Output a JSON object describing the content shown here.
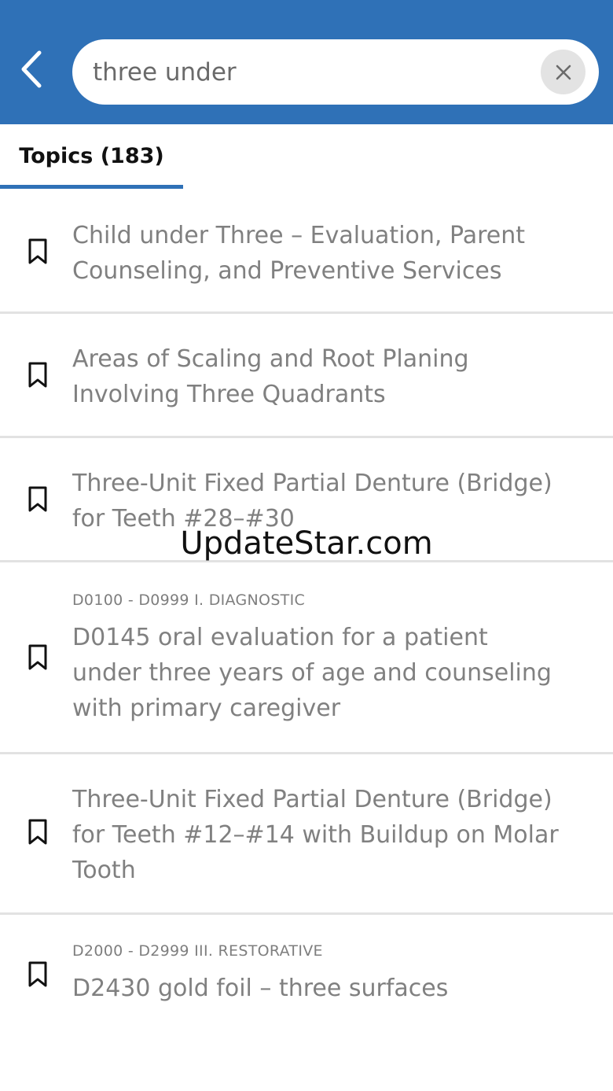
{
  "header": {
    "back_icon": "chevron-left-icon",
    "search": {
      "value": "three under",
      "placeholder": "",
      "clear_icon": "close-icon"
    },
    "colors": {
      "bar": "#2f71b7"
    }
  },
  "tabs": [
    {
      "label": "Topics (183)",
      "active": true
    }
  ],
  "results": [
    {
      "category": "",
      "title_lines": [
        "Child under Three – Evaluation, Parent",
        "Counseling, and Preventive Services"
      ],
      "icon": "bookmark-icon"
    },
    {
      "category": "",
      "title_lines": [
        "Areas of Scaling and Root Planing",
        "Involving Three Quadrants"
      ],
      "icon": "bookmark-icon"
    },
    {
      "category": "",
      "title_lines": [
        "Three-Unit Fixed Partial Denture (Bridge)",
        "for Teeth #28–#30"
      ],
      "icon": "bookmark-icon"
    },
    {
      "category": "D0100 - D0999 I. DIAGNOSTIC",
      "title_lines": [
        "D0145 oral evaluation for a patient",
        "under three years of age and counseling",
        "with primary caregiver"
      ],
      "icon": "bookmark-icon"
    },
    {
      "category": "",
      "title_lines": [
        "Three-Unit Fixed Partial Denture (Bridge)",
        "for Teeth #12–#14 with Buildup on Molar",
        "Tooth"
      ],
      "icon": "bookmark-icon"
    },
    {
      "category": "D2000 - D2999 III. RESTORATIVE",
      "title_lines": [
        "D2430 gold foil – three surfaces"
      ],
      "icon": "bookmark-icon"
    }
  ],
  "watermark": "UpdateStar.com"
}
